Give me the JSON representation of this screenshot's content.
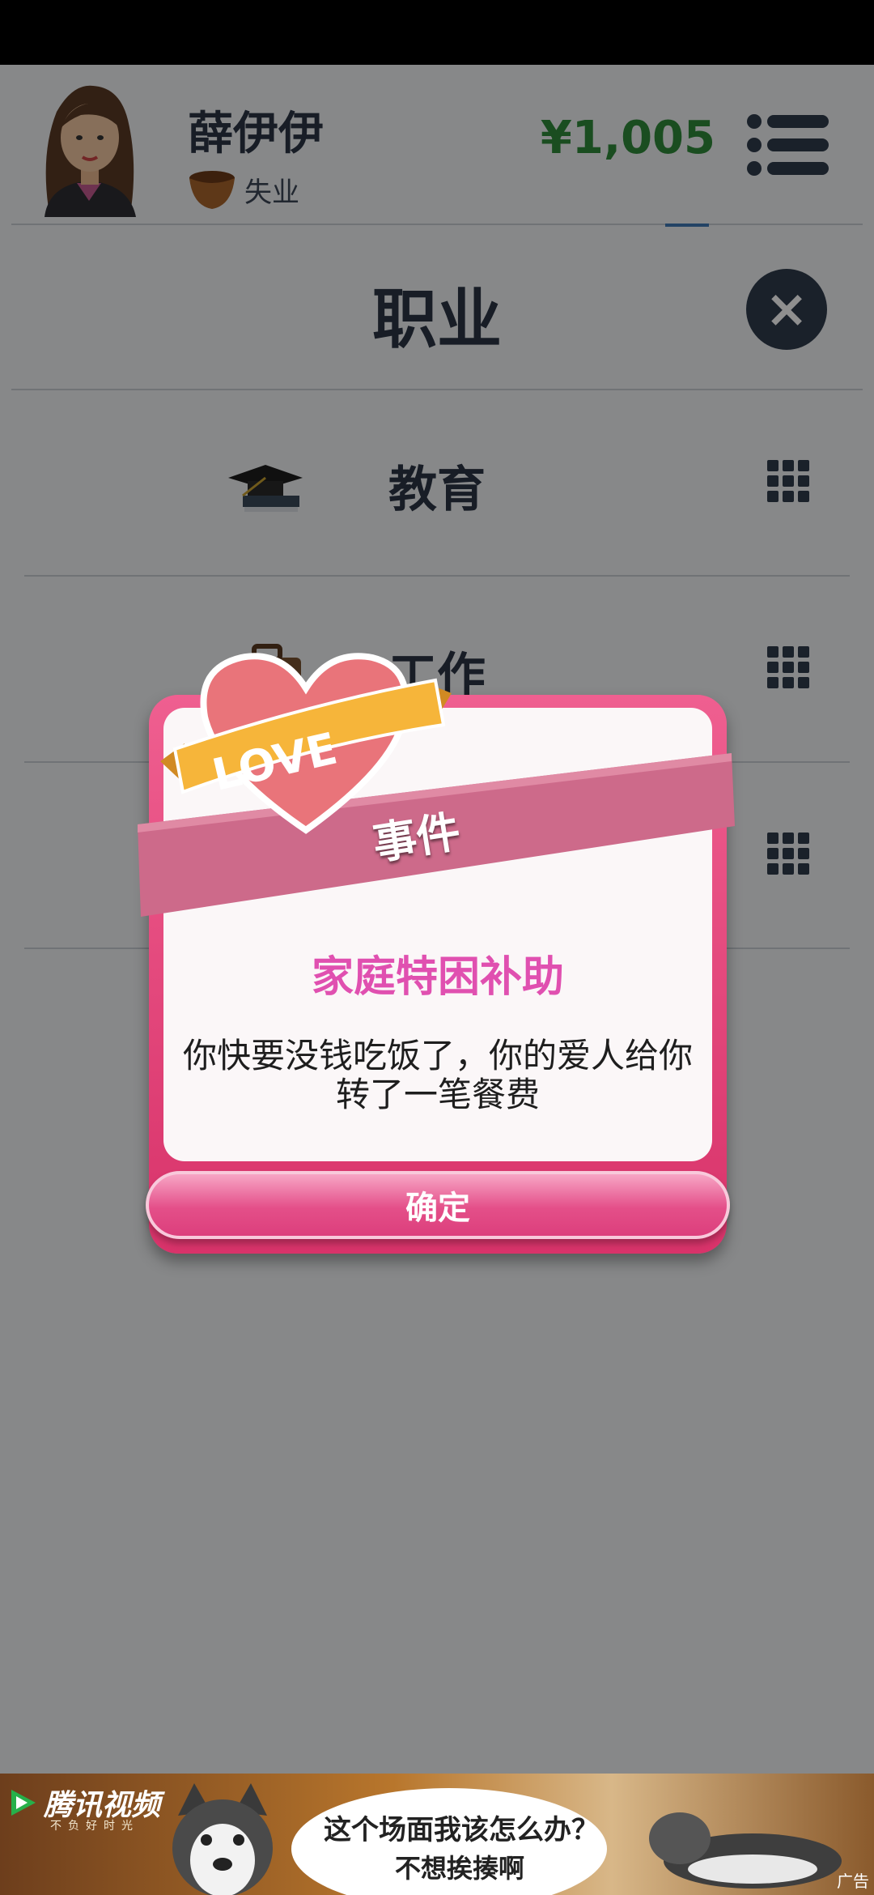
{
  "header": {
    "username": "薛伊伊",
    "status": "失业",
    "money": "¥1,005"
  },
  "section": {
    "title": "职业",
    "rows": [
      {
        "label": "教育"
      },
      {
        "label": "工作"
      },
      {
        "label": ""
      }
    ]
  },
  "modal": {
    "heart_text": "LOVE",
    "ribbon": "事件",
    "title": "家庭特困补助",
    "description": "你快要没钱吃饭了，你的爱人给你转了一笔餐费",
    "confirm": "确定"
  },
  "ad": {
    "brand": "腾讯视频",
    "slogan": "不负好时光",
    "line1": "这个场面我该怎么办？",
    "line2": "不想挨揍啊",
    "tag": "广告"
  },
  "colors": {
    "money": "#2f8a3a",
    "event_title": "#e050b0",
    "modal_frame": "#e0457b"
  }
}
